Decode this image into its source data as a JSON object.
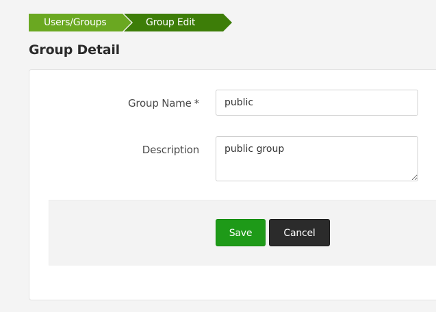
{
  "breadcrumb": {
    "items": [
      {
        "label": "Users/Groups"
      },
      {
        "label": "Group Edit"
      }
    ]
  },
  "page": {
    "title": "Group Detail"
  },
  "form": {
    "group_name": {
      "label": "Group Name",
      "required_marker": "*",
      "value": "public"
    },
    "description": {
      "label": "Description",
      "value": "public group"
    }
  },
  "actions": {
    "save_label": "Save",
    "cancel_label": "Cancel"
  },
  "colors": {
    "breadcrumb_first": "#6aa821",
    "breadcrumb_active": "#3d7d08",
    "save_button": "#1e9a18",
    "cancel_button": "#2b2b2b"
  }
}
